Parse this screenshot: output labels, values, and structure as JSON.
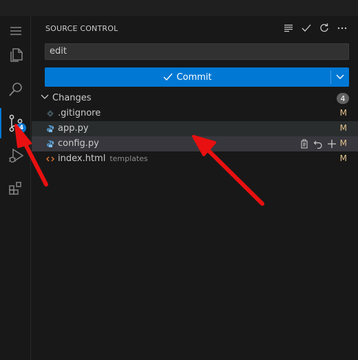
{
  "activity_bar": {
    "items": [
      "menu-icon",
      "explorer-icon",
      "search-icon",
      "source-control-icon",
      "run-debug-icon",
      "extensions-icon"
    ],
    "scm_badge": "4"
  },
  "header": {
    "title": "SOURCE CONTROL",
    "actions": [
      "view-as-tree-icon",
      "commit-check-icon",
      "refresh-icon",
      "more-actions-icon"
    ]
  },
  "commit_message": {
    "value": "edit"
  },
  "commit_button": {
    "label": "Commit"
  },
  "changes": {
    "label": "Changes",
    "count": "4",
    "files": [
      {
        "name": ".gitignore",
        "dir": "",
        "status": "M",
        "icon": "gitignore-file-icon"
      },
      {
        "name": "app.py",
        "dir": "",
        "status": "M",
        "icon": "python-file-icon"
      },
      {
        "name": "config.py",
        "dir": "",
        "status": "M",
        "icon": "python-file-icon"
      },
      {
        "name": "index.html",
        "dir": "templates",
        "status": "M",
        "icon": "html-file-icon"
      }
    ]
  },
  "colors": {
    "accent": "#0078d4",
    "modified": "#e2c08d",
    "annotation_arrow": "#e81010"
  }
}
